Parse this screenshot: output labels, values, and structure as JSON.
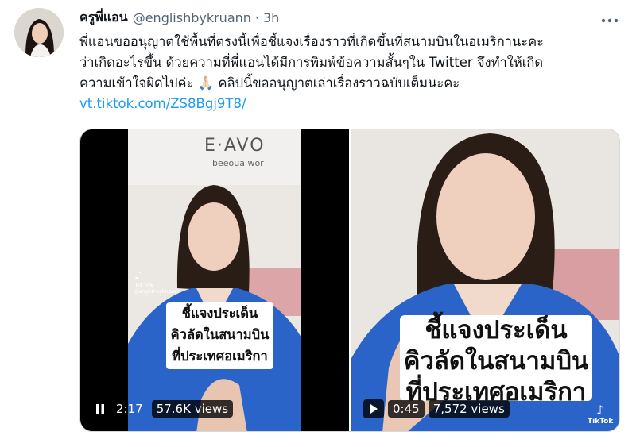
{
  "tweet": {
    "author_name": "ครูพี่แอน",
    "handle": "@englishbykruann",
    "separator": "·",
    "time": "3h",
    "more_icon": "more-horizontal-icon",
    "text_lines": [
      "พี่แอนขออนุญาตใช้พื้นที่ตรงนี้เพื่อชี้แจงเรื่องราวที่เกิดขึ้นที่สนามบินในอเมริกานะคะ",
      "ว่าเกิดอะไรขึ้น  ด้วยความที่พี่แอนได้มีการพิมพ์ข้อความสั้นๆใน Twitter จึงทำให้เกิด",
      "ความเข้าใจผิดไปค่ะ  🙏🏻  คลิปนี้ขออนุญาตเล่าเรื่องราวฉบับเต็มนะคะ"
    ],
    "link": "vt.tiktok.com/ZS8Bgj9T8/"
  },
  "media": [
    {
      "overlay_lines": [
        "ชี้แจงประเด็น",
        "คิวลัดในสนามบิน",
        "ที่ประเทศอเมริกา"
      ],
      "play_state_icon": "pause-icon",
      "duration": "2:17",
      "views": "57.6K views",
      "tiktok_label": "TikTok",
      "tiktok_handle": "@englishbykruann",
      "wall_text": "E·AVO",
      "wall_subtext": "beeoua wor"
    },
    {
      "overlay_lines": [
        "ชี้แจงประเด็น",
        "คิวลัดในสนามบิน",
        "ที่ประเทศอเมริกา"
      ],
      "play_state_icon": "play-icon",
      "duration": "0:45",
      "views": "7,572 views",
      "tiktok_label": "TikTok"
    }
  ],
  "colors": {
    "link": "#1d9bf0",
    "jacket": "#2a64c8",
    "secondary_text": "#536471"
  }
}
